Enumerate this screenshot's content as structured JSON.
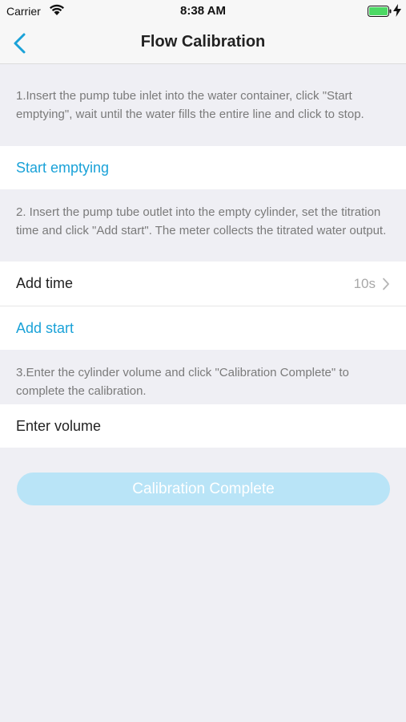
{
  "status_bar": {
    "carrier": "Carrier",
    "time": "8:38 AM",
    "icons": [
      "wifi-icon",
      "battery-icon",
      "charging-icon"
    ],
    "battery_color": "#4cd964"
  },
  "nav": {
    "title": "Flow Calibration",
    "back_icon": "chevron-left-icon"
  },
  "step1": {
    "hint": "1.Insert the pump tube inlet into the water container, click \"Start emptying\", wait until the water fills the entire line and click to stop.",
    "action_label": "Start emptying"
  },
  "step2": {
    "hint": "2. Insert the pump tube outlet into the empty cylinder, set the titration time and click \"Add start\". The meter collects the titrated water output.",
    "time_label": "Add time",
    "time_value": "10s",
    "action_label": "Add start"
  },
  "step3": {
    "hint": "3.Enter the cylinder volume and click \"Calibration Complete\" to complete the calibration.",
    "volume_placeholder": "Enter volume"
  },
  "complete_button": {
    "label": "Calibration Complete"
  },
  "colors": {
    "accent": "#1aa2d8",
    "button_disabled": "#b9e4f7",
    "background": "#efeff4"
  }
}
